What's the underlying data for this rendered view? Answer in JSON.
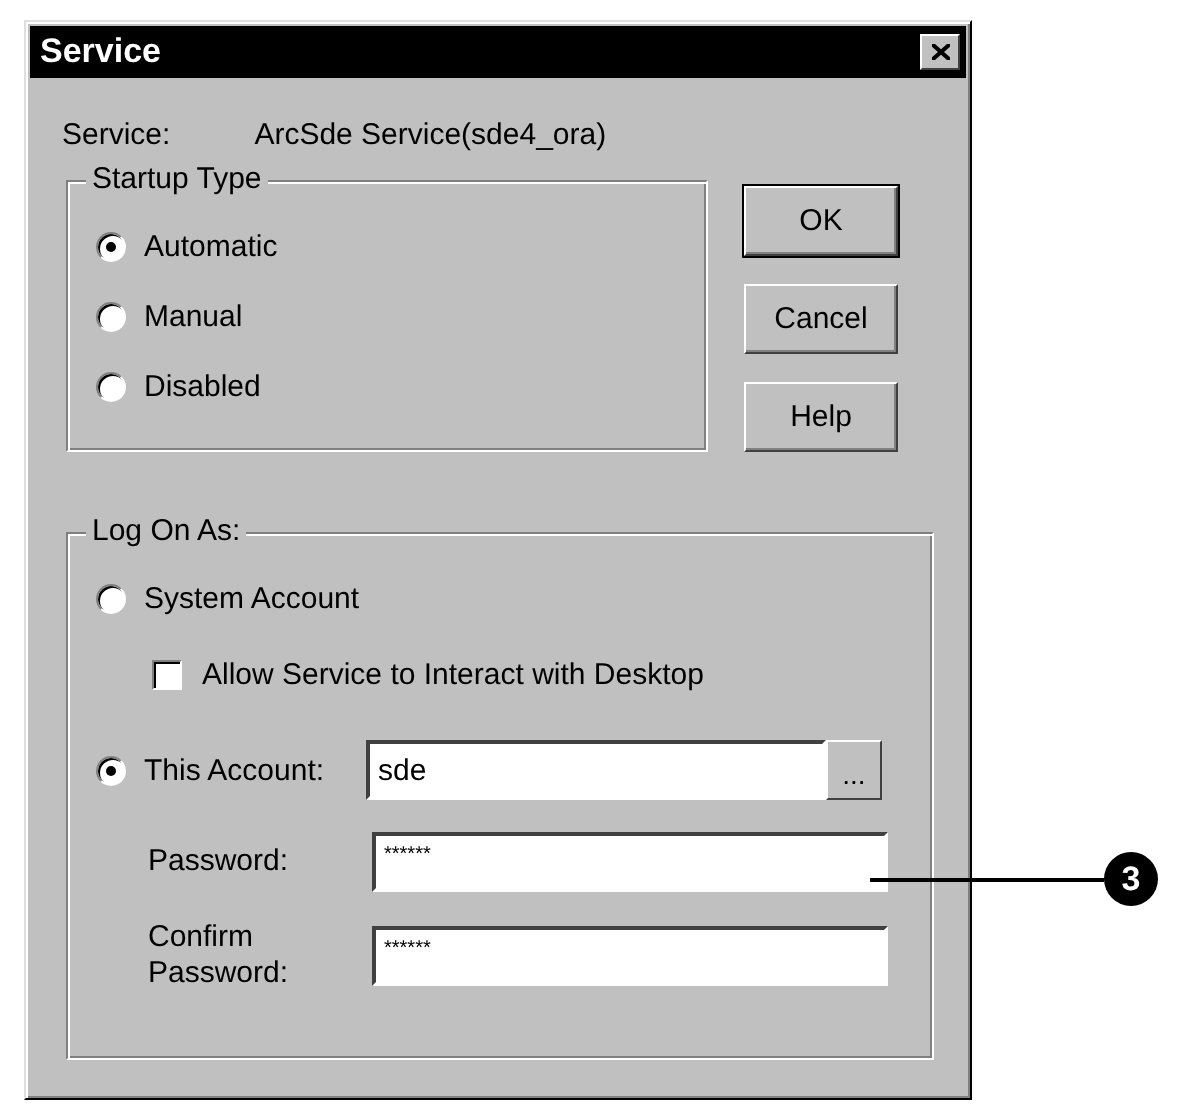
{
  "window": {
    "title": "Service"
  },
  "service": {
    "label": "Service:",
    "value": "ArcSde Service(sde4_ora)"
  },
  "startup_type": {
    "legend": "Startup Type",
    "options": [
      {
        "label": "Automatic",
        "selected": true
      },
      {
        "label": "Manual",
        "selected": false
      },
      {
        "label": "Disabled",
        "selected": false
      }
    ]
  },
  "buttons": [
    {
      "label": "OK",
      "default": true
    },
    {
      "label": "Cancel",
      "default": false
    },
    {
      "label": "Help",
      "default": false
    }
  ],
  "log_on_as": {
    "legend": "Log On As:",
    "system_account": {
      "label": "System Account",
      "selected": false
    },
    "allow_desktop": {
      "label": "Allow Service to Interact with Desktop",
      "checked": false
    },
    "this_account": {
      "label": "This Account:",
      "selected": true,
      "value": "sde",
      "browse": "..."
    },
    "password": {
      "label": "Password:",
      "value": "******"
    },
    "confirm_password": {
      "label": "Confirm Password:",
      "value": "******"
    }
  },
  "callout": {
    "number": "3"
  }
}
